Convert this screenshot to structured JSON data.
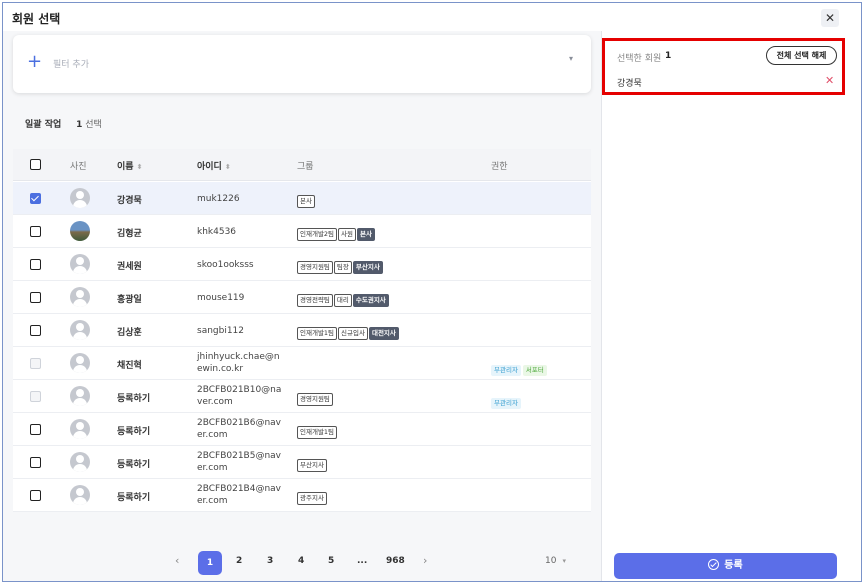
{
  "dialog": {
    "title": "회원 선택",
    "close_glyph": "✕"
  },
  "filter": {
    "add_glyph": "+",
    "placeholder": "필터 추가",
    "chevron": "▾"
  },
  "bulk": {
    "label": "일괄 작업",
    "count": "1",
    "suffix": "선택"
  },
  "table": {
    "headers": {
      "photo": "사진",
      "name": "이름",
      "id": "아이디",
      "group": "그룹",
      "role": "권한",
      "sort_glyph": "⬍"
    },
    "rows": [
      {
        "checked": true,
        "disabled": false,
        "photo": "default",
        "name": "강경묵",
        "id": "muk1226",
        "groups": [
          {
            "t": "본사",
            "dark": false
          }
        ],
        "roles": []
      },
      {
        "checked": false,
        "disabled": false,
        "photo": "photo",
        "name": "김형균",
        "id": "khk4536",
        "groups": [
          {
            "t": "인재개발2팀",
            "dark": false
          },
          {
            "t": "사원",
            "dark": false
          },
          {
            "t": "본사",
            "dark": true
          }
        ],
        "roles": []
      },
      {
        "checked": false,
        "disabled": false,
        "photo": "default",
        "name": "권세원",
        "id": "skoo1ooksss",
        "groups": [
          {
            "t": "경영지원팀",
            "dark": false
          },
          {
            "t": "팀장",
            "dark": false
          },
          {
            "t": "부산지사",
            "dark": true
          }
        ],
        "roles": []
      },
      {
        "checked": false,
        "disabled": false,
        "photo": "default",
        "name": "홍광일",
        "id": "mouse119",
        "groups": [
          {
            "t": "경영전략팀",
            "dark": false
          },
          {
            "t": "대리",
            "dark": false
          },
          {
            "t": "수도권지사",
            "dark": true
          }
        ],
        "roles": []
      },
      {
        "checked": false,
        "disabled": false,
        "photo": "default",
        "name": "김상훈",
        "id": "sangbi112",
        "groups": [
          {
            "t": "인재개발1팀",
            "dark": false
          },
          {
            "t": "신규입사",
            "dark": false
          },
          {
            "t": "대전지사",
            "dark": true
          }
        ],
        "roles": []
      },
      {
        "checked": false,
        "disabled": true,
        "photo": "default",
        "name": "채진혁",
        "id": "jhinhyuck.chae@newin.co.kr",
        "groups": [],
        "roles": [
          {
            "t": "부관리자",
            "kind": "sub"
          },
          {
            "t": "서포터",
            "kind": "sup"
          }
        ]
      },
      {
        "checked": false,
        "disabled": true,
        "photo": "default",
        "name": "등록하기",
        "id": "2BCFB021B10@naver.com",
        "groups": [
          {
            "t": "경영지원팀",
            "dark": false
          }
        ],
        "roles": [
          {
            "t": "부관리자",
            "kind": "sub"
          }
        ]
      },
      {
        "checked": false,
        "disabled": false,
        "photo": "default",
        "name": "등록하기",
        "id": "2BCFB021B6@naver.com",
        "groups": [
          {
            "t": "인재개발1팀",
            "dark": false
          }
        ],
        "roles": []
      },
      {
        "checked": false,
        "disabled": false,
        "photo": "default",
        "name": "등록하기",
        "id": "2BCFB021B5@naver.com",
        "groups": [
          {
            "t": "부산지사",
            "dark": false
          }
        ],
        "roles": []
      },
      {
        "checked": false,
        "disabled": false,
        "photo": "default",
        "name": "등록하기",
        "id": "2BCFB021B4@naver.com",
        "groups": [
          {
            "t": "광주지사",
            "dark": false
          }
        ],
        "roles": []
      }
    ]
  },
  "pagination": {
    "prev": "‹",
    "next": "›",
    "pages": [
      "1",
      "2",
      "3",
      "4",
      "5",
      "...",
      "968"
    ],
    "active": "1",
    "page_size": "10",
    "page_size_chevron": "▾"
  },
  "selection": {
    "label": "선택한 회원",
    "count": "1",
    "clear_label": "전체 선택 해제",
    "items": [
      "강경묵"
    ],
    "remove_glyph": "✕"
  },
  "submit": {
    "label": "등록"
  },
  "colors": {
    "accent": "#5b6ee8",
    "highlight_border": "#e50000",
    "remove": "#e0506a"
  }
}
